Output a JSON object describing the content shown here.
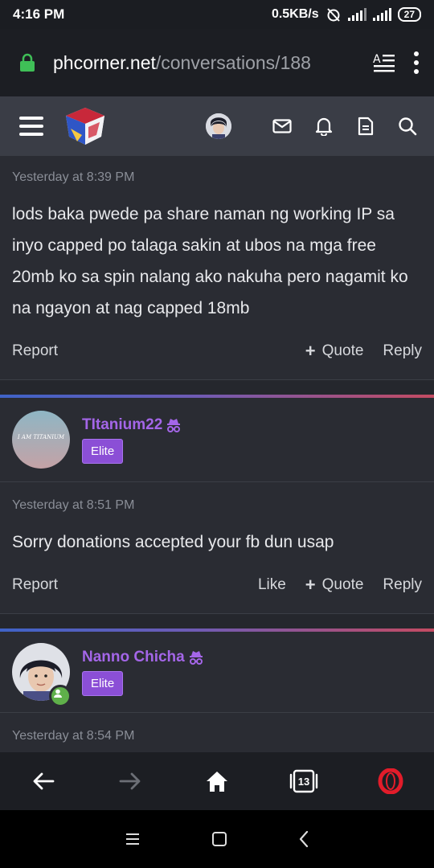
{
  "status": {
    "time": "4:16 PM",
    "speed": "0.5KB/s",
    "battery": "27"
  },
  "browser": {
    "url_host": "phcorner.net",
    "url_path": "/conversations/188",
    "tab_count": "13"
  },
  "messages": [
    {
      "timestamp": "Yesterday at 8:39 PM",
      "text": "lods baka pwede pa share naman ng working IP sa inyo capped po talaga sakin at ubos na mga free 20mb ko sa spin nalang ako nakuha pero nagamit ko na ngayon at nag capped 18mb",
      "report": "Report",
      "quote": "Quote",
      "reply": "Reply"
    },
    {
      "author": "TItanium22",
      "avatar_text": "I AM TITANIUM",
      "role": "Elite",
      "timestamp": "Yesterday at 8:51 PM",
      "text": "Sorry donations accepted your fb dun usap",
      "report": "Report",
      "like": "Like",
      "quote": "Quote",
      "reply": "Reply"
    },
    {
      "author": "Nanno Chicha",
      "role": "Elite",
      "timestamp": "Yesterday at 8:54 PM"
    }
  ],
  "colors": {
    "accent": "#a466e8",
    "badge": "#8b4fd6",
    "online": "#5fb04a"
  }
}
